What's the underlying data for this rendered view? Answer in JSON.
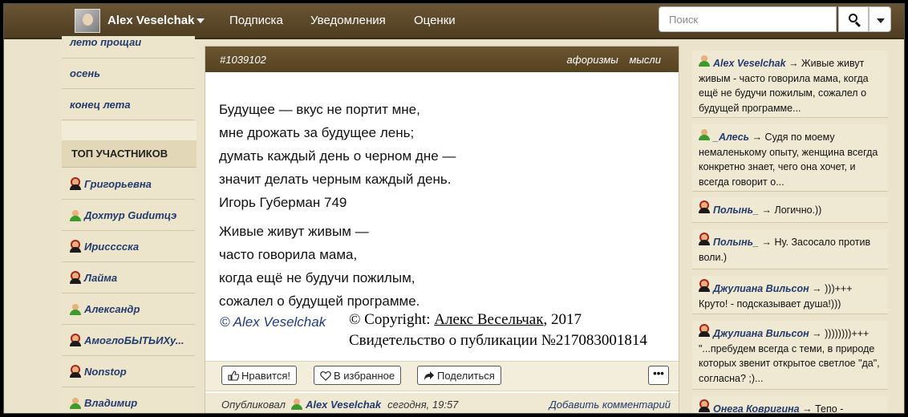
{
  "header": {
    "user_name": "Alex Veselchak",
    "nav": [
      "Подписка",
      "Уведомления",
      "Оценки"
    ],
    "search_placeholder": "Поиск"
  },
  "left_sidebar": {
    "tag_links": [
      "лето прощаи",
      "осень",
      "конец лета"
    ],
    "top_title": "ТОП УЧАСТНИКОВ",
    "members": [
      {
        "name": "Григорьевна",
        "gender": "female"
      },
      {
        "name": "Дохтур Gudитцэ",
        "gender": "male"
      },
      {
        "name": "Ирисссска",
        "gender": "female"
      },
      {
        "name": "Лайма",
        "gender": "female"
      },
      {
        "name": "Александр",
        "gender": "male"
      },
      {
        "name": "АмоглоБЫТЬИХу...",
        "gender": "female"
      },
      {
        "name": "Nonstop",
        "gender": "female"
      },
      {
        "name": "Владимир",
        "gender": "male"
      }
    ]
  },
  "post": {
    "id": "#1039102",
    "tags": [
      "афоризмы",
      "мысли"
    ],
    "stanza1": [
      "Будущее — вкус не портит мне,",
      "мне дрожать за будущее лень;",
      "думать каждый день о черном дне —",
      "значит делать черным каждый день.",
      "Игорь Губерман 749"
    ],
    "stanza2": [
      "Живые живут живым —",
      "часто говорила мама,",
      "когда ещё не будучи пожилым,",
      "сожалел о будущей программе."
    ],
    "signature": "© Alex Veselchak",
    "copyright_prefix": "© Copyright: ",
    "copyright_author": "Алекс Весельчак",
    "copyright_year": ", 2017",
    "certificate": "Свидетельство о публикации №217083001814",
    "buttons": {
      "like": "Нравится!",
      "favorite": "В избранное",
      "share": "Поделиться",
      "more": "•••"
    },
    "footer": {
      "published_label": "Опубликовал",
      "author": "Alex Veselchak",
      "time": "сегодня, 19:57",
      "add_comment": "Добавить комментарий"
    }
  },
  "right_sidebar": {
    "comments": [
      {
        "author": "Alex Veselchak",
        "gender": "male",
        "text": "Живые живут живым - часто говорила мама, когда ещё не будучи пожилым, сожалел о будущей программе..."
      },
      {
        "author": "_Алесь",
        "gender": "male",
        "text": "Судя по моему немаленькому опыту, женщина всегда конкретно знает, чего она хочет, и всегда говорит о..."
      },
      {
        "author": "Полынь_",
        "gender": "female",
        "text": "Логично.))"
      },
      {
        "author": "Полынь_",
        "gender": "female",
        "text": "Ну. Засосало против воли.)"
      },
      {
        "author": "Джулиана Вильсон",
        "gender": "female",
        "text": ")))+++ Круто! - подсказывает душа!)))"
      },
      {
        "author": "Джулиана Вильсон",
        "gender": "female",
        "text": "))))))))+++ \"...пребудем всегда с теми, в природе которых звенит открытое светлое \"да\", согласна? ;)..."
      },
      {
        "author": "Онега Ковригина",
        "gender": "female",
        "text": "Тепо -"
      }
    ]
  }
}
